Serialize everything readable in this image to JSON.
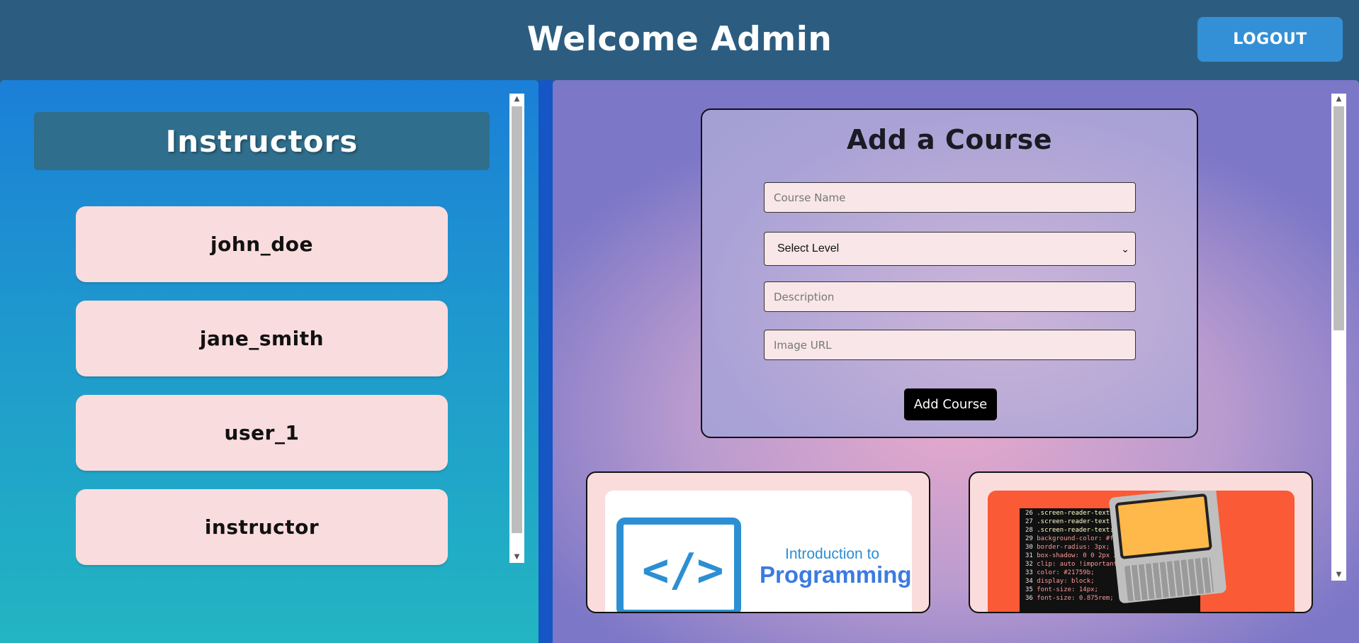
{
  "header": {
    "title": "Welcome Admin",
    "logout_label": "LOGOUT"
  },
  "instructors": {
    "title": "Instructors",
    "items": [
      {
        "name": "john_doe"
      },
      {
        "name": "jane_smith"
      },
      {
        "name": "user_1"
      },
      {
        "name": "instructor"
      }
    ]
  },
  "course_form": {
    "title": "Add a Course",
    "course_name_placeholder": "Course Name",
    "level_selected": "Select Level",
    "description_placeholder": "Description",
    "image_url_placeholder": "Image URL",
    "submit_label": "Add Course"
  },
  "courses": [
    {
      "image_text_line1": "Introduction to",
      "image_text_line2": "Programming",
      "image_glyph": "</>"
    },
    {
      "image_code_lines": [
        ".screen-reader-text:hov",
        ".screen-reader-text:acti",
        ".screen-reader-text:focu",
        "background-color: #f1",
        "border-radius: 3px;",
        "box-shadow: 0 0 2px 2",
        "clip: auto !important;",
        "color: #21759b;",
        "display: block;",
        "font-size: 14px;",
        "font-size: 0.875rem;"
      ],
      "image_line_numbers": [
        "26",
        "27",
        "28",
        "29",
        "30",
        "31",
        "32",
        "33",
        "34",
        "35",
        "36"
      ]
    }
  ],
  "colors": {
    "header_bg": "#2c5d80",
    "logout_bg": "#3390d6",
    "instructor_card_bg": "#f9dcdd",
    "add_button_bg": "#000000"
  }
}
